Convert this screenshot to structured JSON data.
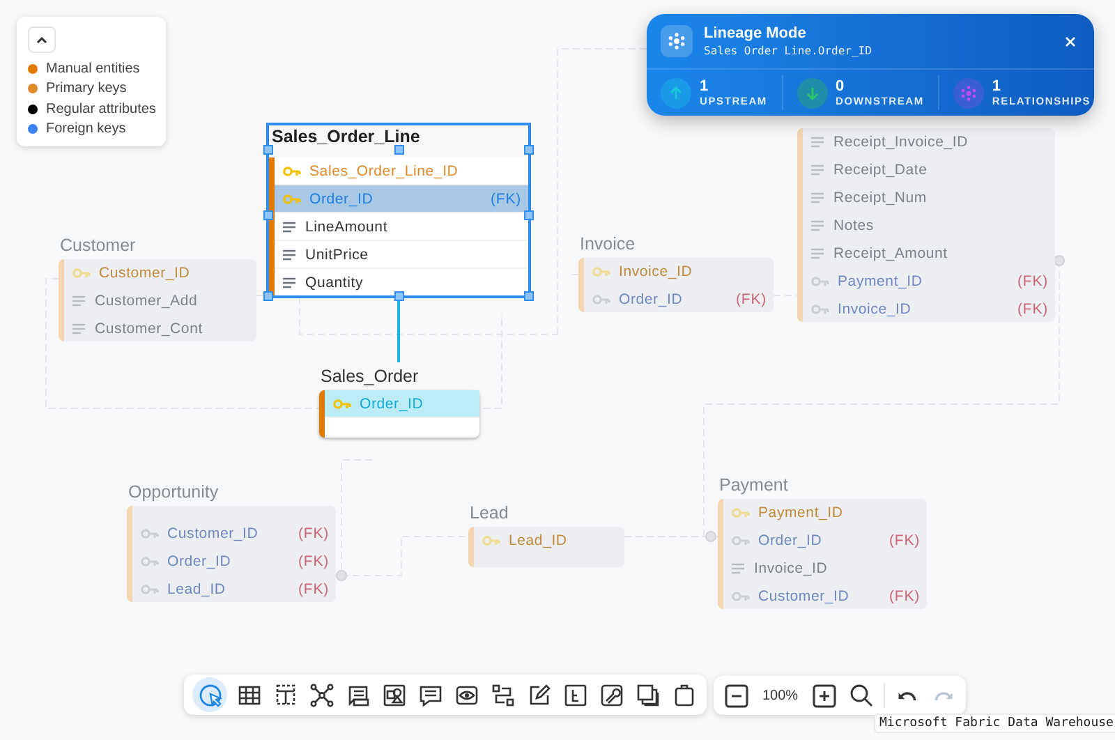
{
  "legend": {
    "items": [
      {
        "label": "Manual entities",
        "color": "#e07b00"
      },
      {
        "label": "Primary keys",
        "color": "#e08a2a"
      },
      {
        "label": "Regular attributes",
        "color": "#000000"
      },
      {
        "label": "Foreign keys",
        "color": "#3b82f6"
      }
    ]
  },
  "entities": [
    {
      "name": "Sales_Order_Line",
      "faded": false,
      "selected": true,
      "fields": [
        {
          "kind": "pk",
          "name": "Sales_Order_Line_ID",
          "highlighted": false
        },
        {
          "kind": "fk",
          "name": "Order_ID",
          "tag": "(FK)",
          "highlighted": true
        },
        {
          "kind": "regular",
          "name": "LineAmount",
          "highlighted": false
        },
        {
          "kind": "regular",
          "name": "UnitPrice",
          "highlighted": false
        },
        {
          "kind": "regular",
          "name": "Quantity",
          "highlighted": false
        }
      ]
    },
    {
      "name": "Sales_Order",
      "faded": false,
      "selected": false,
      "fields": [
        {
          "kind": "pk",
          "name": "Order_ID",
          "highlighted": true
        },
        {
          "kind": "empty"
        }
      ]
    },
    {
      "name": "Customer",
      "faded": true,
      "selected": false,
      "fields": [
        {
          "kind": "pk",
          "name": "Customer_ID",
          "highlighted": false
        },
        {
          "kind": "regular",
          "name": "Customer_Add",
          "highlighted": false
        },
        {
          "kind": "regular",
          "name": "Customer_Cont",
          "highlighted": false
        }
      ]
    },
    {
      "name": "Invoice",
      "faded": true,
      "selected": false,
      "fields": [
        {
          "kind": "pk",
          "name": "Invoice_ID",
          "highlighted": false
        },
        {
          "kind": "fk",
          "name": "Order_ID",
          "tag": "(FK)",
          "highlighted": false
        }
      ]
    },
    {
      "faded": true,
      "selected": false,
      "fields": [
        {
          "kind": "regular",
          "name": "Receipt_Invoice_ID",
          "highlighted": false
        },
        {
          "kind": "regular",
          "name": "Receipt_Date",
          "highlighted": false
        },
        {
          "kind": "regular",
          "name": "Receipt_Num",
          "highlighted": false
        },
        {
          "kind": "regular",
          "name": "Notes",
          "highlighted": false
        },
        {
          "kind": "regular",
          "name": "Receipt_Amount",
          "highlighted": false
        },
        {
          "kind": "fk",
          "name": "Payment_ID",
          "tag": "(FK)",
          "highlighted": false
        },
        {
          "kind": "fk",
          "name": "Invoice_ID",
          "tag": "(FK)",
          "highlighted": false
        }
      ]
    },
    {
      "name": "Opportunity",
      "faded": true,
      "selected": false,
      "fields": [
        {
          "kind": "empty"
        },
        {
          "kind": "fk",
          "name": "Customer_ID",
          "tag": "(FK)",
          "highlighted": false
        },
        {
          "kind": "fk",
          "name": "Order_ID",
          "tag": "(FK)",
          "highlighted": false
        },
        {
          "kind": "fk",
          "name": "Lead_ID",
          "tag": "(FK)",
          "highlighted": false
        }
      ]
    },
    {
      "name": "Lead",
      "faded": true,
      "selected": false,
      "fields": [
        {
          "kind": "pk",
          "name": "Lead_ID",
          "highlighted": false
        },
        {
          "kind": "empty"
        }
      ]
    },
    {
      "name": "Payment",
      "faded": true,
      "selected": false,
      "fields": [
        {
          "kind": "pk",
          "name": "Payment_ID",
          "highlighted": false
        },
        {
          "kind": "fk",
          "name": "Order_ID",
          "tag": "(FK)",
          "highlighted": false
        },
        {
          "kind": "regular",
          "name": "Invoice_ID",
          "highlighted": false
        },
        {
          "kind": "fk",
          "name": "Customer_ID",
          "tag": "(FK)",
          "highlighted": false
        }
      ]
    }
  ],
  "lineage": {
    "title": "Lineage Mode",
    "subtitle": "Sales Order Line.Order_ID",
    "stats": [
      {
        "kind": "upstream",
        "value": "1",
        "label": "UPSTREAM"
      },
      {
        "kind": "downstream",
        "value": "0",
        "label": "DOWNSTREAM"
      },
      {
        "kind": "relationships",
        "value": "1",
        "label": "RELATIONSHIPS"
      }
    ]
  },
  "toolbar": {
    "tools": [
      {
        "kind": "select",
        "selected": true
      },
      {
        "kind": "table",
        "selected": false
      },
      {
        "kind": "view",
        "selected": false
      },
      {
        "kind": "network",
        "selected": false
      },
      {
        "kind": "notes",
        "selected": false
      },
      {
        "kind": "shapes",
        "selected": false
      },
      {
        "kind": "comment",
        "selected": false
      },
      {
        "kind": "eye",
        "selected": false
      },
      {
        "kind": "layout",
        "selected": false
      },
      {
        "kind": "edit",
        "selected": false
      },
      {
        "kind": "tree",
        "selected": false
      },
      {
        "kind": "wrench",
        "selected": false
      },
      {
        "kind": "layers",
        "selected": false
      },
      {
        "kind": "clipboard",
        "selected": false
      }
    ]
  },
  "zoom": {
    "level_text": "100%",
    "history": [
      {
        "kind": "undo",
        "disabled": false
      },
      {
        "kind": "redo",
        "disabled": true
      }
    ]
  },
  "footer": "Microsoft Fabric Data Warehouse"
}
